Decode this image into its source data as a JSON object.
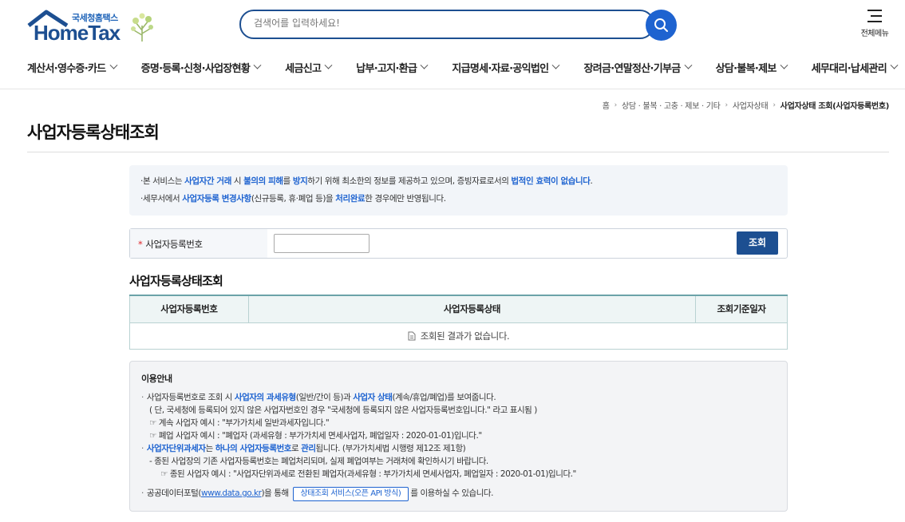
{
  "header": {
    "logo_sub": "국세청홈택스",
    "logo_main": "HomeTax",
    "search_placeholder": "검색어를 입력하세요!",
    "all_menu_label": "전체메뉴"
  },
  "gnb": [
    {
      "label": "계산서·영수증·카드"
    },
    {
      "label": "증명·등록·신청·사업장현황"
    },
    {
      "label": "세금신고"
    },
    {
      "label": "납부·고지·환급"
    },
    {
      "label": "지급명세·자료·공익법인"
    },
    {
      "label": "장려금·연말정산·기부금"
    },
    {
      "label": "상담·불복·제보"
    },
    {
      "label": "세무대리·납세관리"
    }
  ],
  "breadcrumb": {
    "home": "홈",
    "items": [
      "상담 · 불복 · 고충 · 제보 · 기타",
      "사업자상태"
    ],
    "current": "사업자상태 조회(사업자등록번호)"
  },
  "page": {
    "title": "사업자등록상태조회"
  },
  "notice": {
    "line1": {
      "p1": "본 서비스는 ",
      "h1": "사업자간 거래",
      "p2": " 시 ",
      "h2": "불의의 피해",
      "p3": "를 ",
      "h3": "방지",
      "p4": "하기 위해 최소한의 정보를 제공하고 있으며, 증빙자료로서의 ",
      "h4": "법적인 효력이 없습니다",
      "p5": "."
    },
    "line2": {
      "p1": "세무서에서 ",
      "h1": "사업자등록 변경사항",
      "p2": "(신규등록, 휴·폐업 등)을 ",
      "h2": "처리완료",
      "p3": "한 경우에만 반영됩니다."
    }
  },
  "form": {
    "label": "사업자등록번호",
    "required_mark": "*",
    "input_value": "",
    "button_label": "조회"
  },
  "results": {
    "section_title": "사업자등록상태조회",
    "columns": [
      "사업자등록번호",
      "사업자등록상태",
      "조회기준일자"
    ],
    "empty_message": "조회된 결과가 없습니다."
  },
  "info": {
    "title": "이용안내",
    "l1": {
      "p1": "사업자등록번호로 조회 시 ",
      "h1": "사업자의 과세유형",
      "p2": "(일반/간이 등)과 ",
      "h2": "사업자 상태",
      "p3": "(계속/휴업/폐업)를 보여줍니다."
    },
    "l2": "( 단, 국세청에 등록되어 있지 않은 사업자번호인 경우 \"국세청에 등록되지 않은 사업자등록번호입니다.\" 라고 표시됨 )",
    "l3": "☞ 계속 사업자 예시 : \"부가가치세 일반과세자입니다.\"",
    "l4": "☞ 폐업 사업자 예시 : \"폐업자 (과세유형 : 부가가치세 면세사업자, 폐업일자 : 2020-01-01)입니다.\"",
    "l5": {
      "h1": "사업자단위과세자",
      "p1": "는 ",
      "h2": "하나의 사업자등록번호",
      "p2": "로 ",
      "h3": "관리",
      "p3": "됩니다. (부가가치세법 시행령 제12조 제1항)"
    },
    "l6": "- 종된 사업장의 기존 사업자등록번호는 폐업처리되며, 실제 폐업여부는 거래처에 확인하시기 바랍니다.",
    "l7": "☞ 종된 사업자 예시 : \"사업자단위과세로 전환된 폐업자(과세유형 : 부가가치세 면세사업자, 폐업일자 : 2020-01-01)입니다.\"",
    "l8": {
      "p1": "공공데이터포털(",
      "link": "www.data.go.kr",
      "p2": ")을 통해 ",
      "button": "상태조회 서비스(오픈 API 방식)",
      "p3": "를 이용하실 수 있습니다."
    }
  },
  "colors": {
    "brand": "#1d4f91",
    "accent": "#1e63d0",
    "required": "#e0262b",
    "table_header_bg": "#eef5f5"
  },
  "icons": [
    "house-roof-icon",
    "tree-icon",
    "search-icon",
    "hamburger-menu-icon",
    "chevron-down-icon",
    "document-icon"
  ]
}
